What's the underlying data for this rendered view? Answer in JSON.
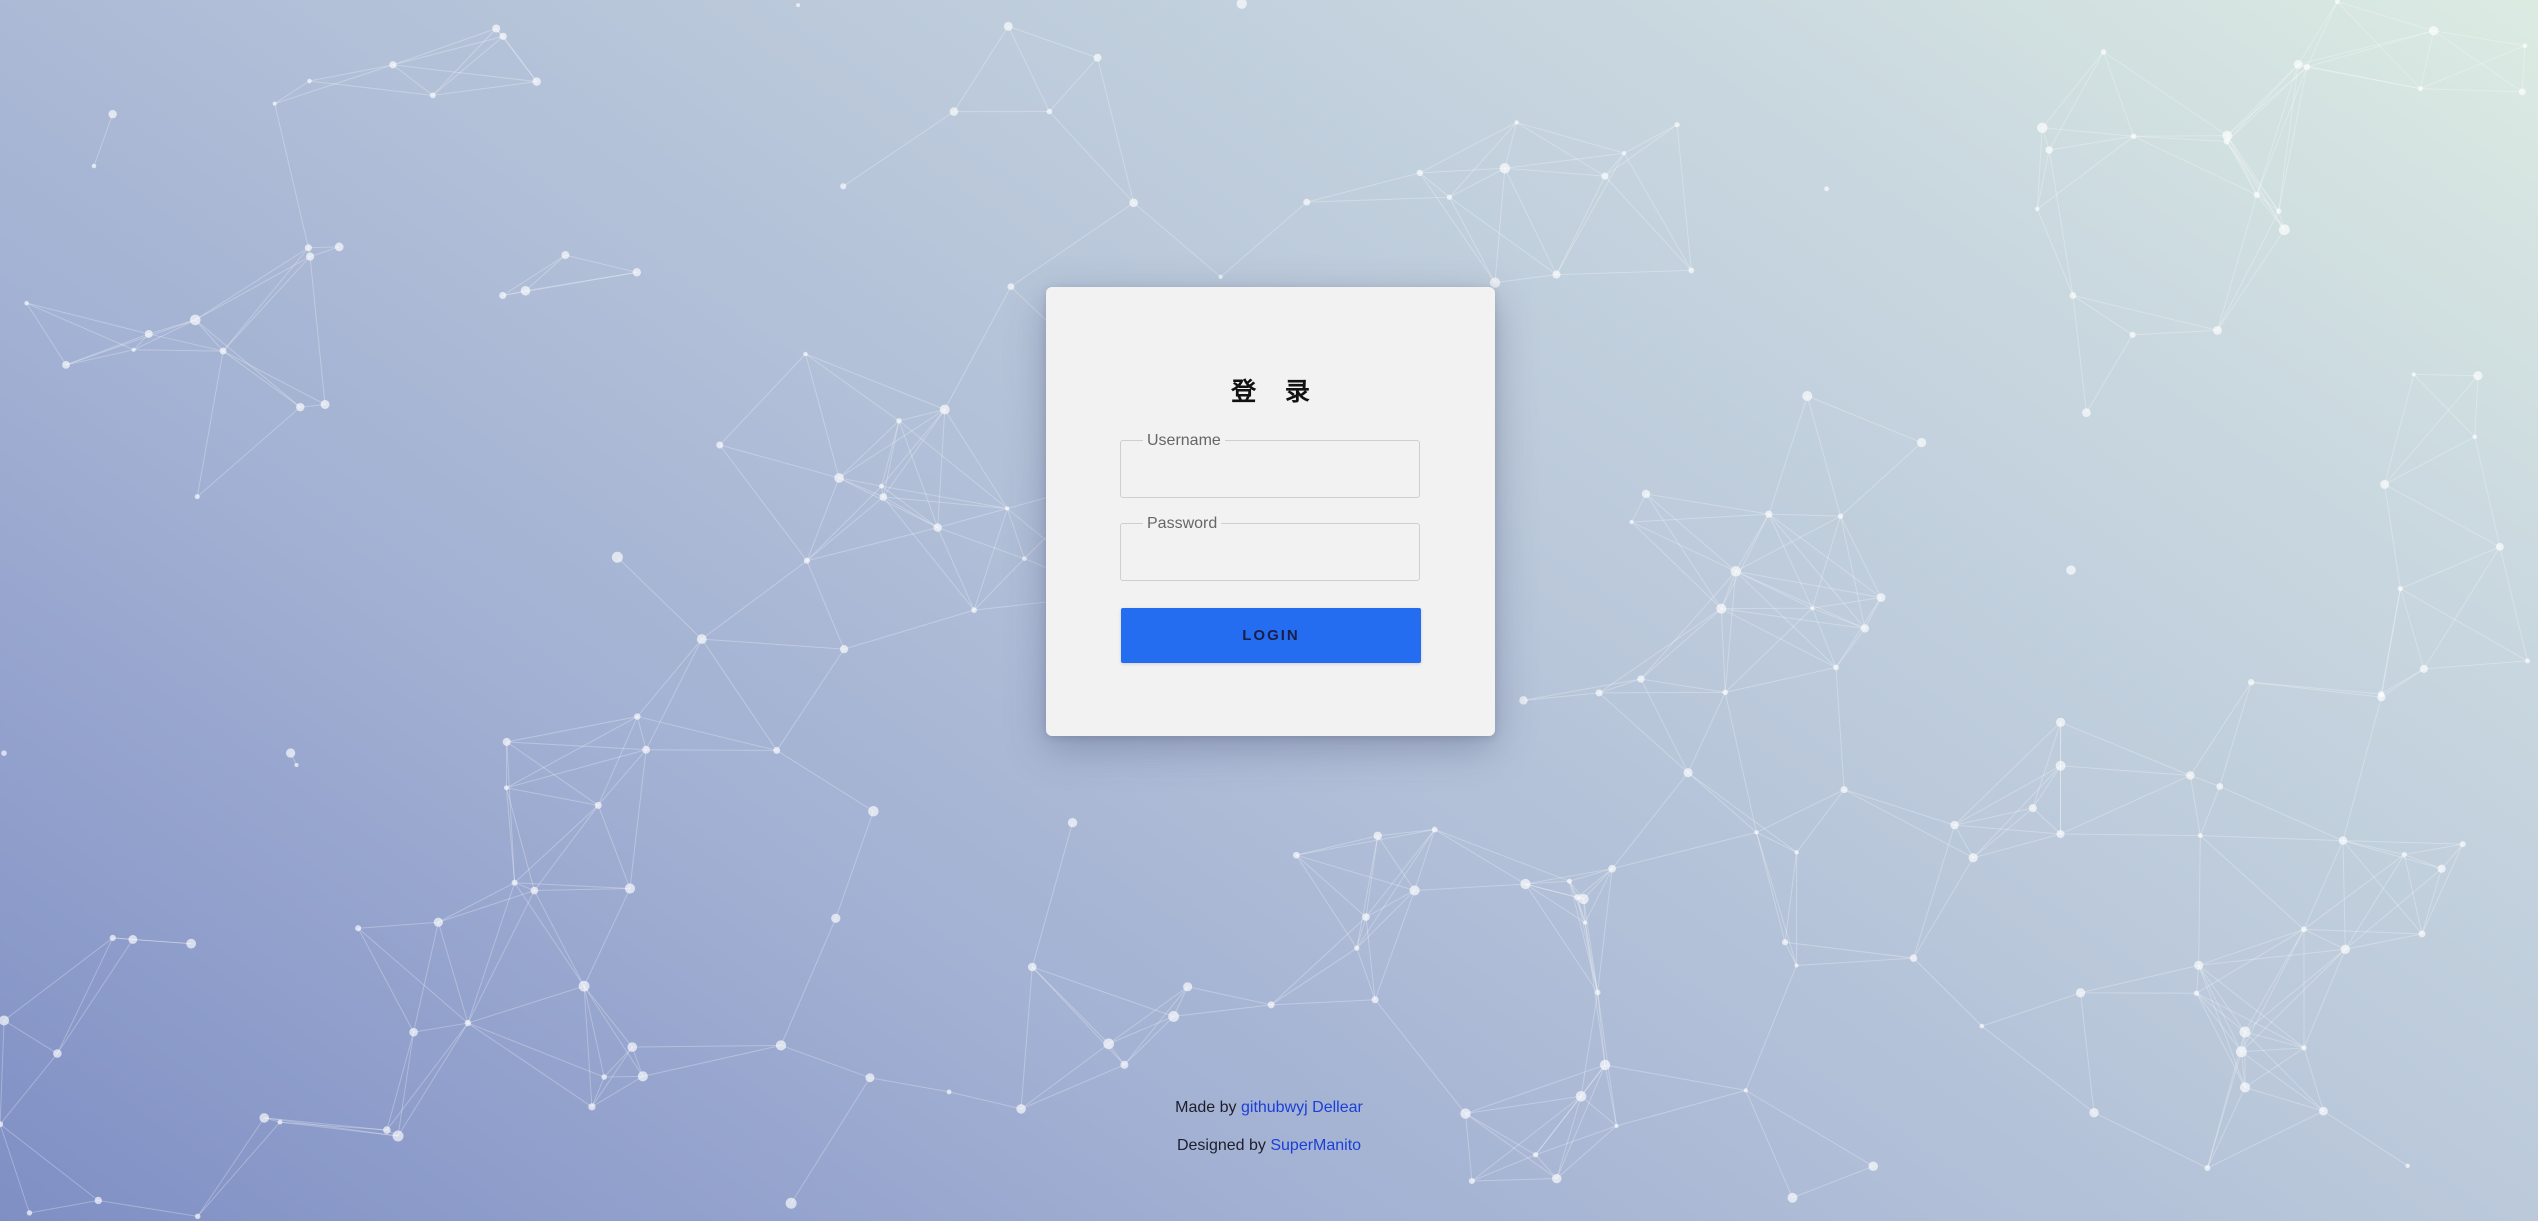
{
  "login_card": {
    "title": "登 录",
    "username_label": "Username",
    "username_value": "",
    "password_label": "Password",
    "password_value": "",
    "login_button": "LOGIN"
  },
  "footer": {
    "made_by_prefix": "Made by",
    "made_by_link": "githubwyj Dellear",
    "designed_by_prefix": "Designed by",
    "designed_by_link": "SuperManito"
  },
  "colors": {
    "button": "#246cf0",
    "link": "#1a3fd6",
    "card": "#f2f2f2"
  }
}
